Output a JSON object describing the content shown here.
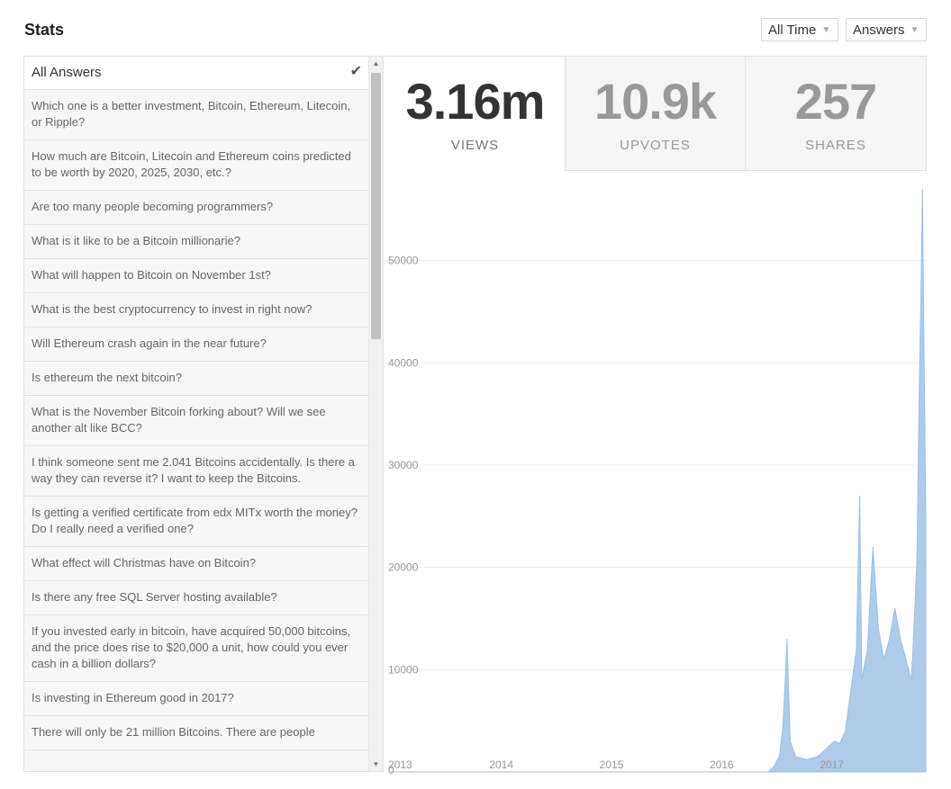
{
  "header": {
    "title": "Stats"
  },
  "filters": {
    "time": "All Time",
    "type": "Answers"
  },
  "sidebar": {
    "selected_label": "All Answers",
    "items": [
      "Which one is a better investment, Bitcoin, Ethereum, Litecoin, or Ripple?",
      "How much are Bitcoin, Litecoin and Ethereum coins predicted to be worth by 2020, 2025, 2030, etc.?",
      "Are too many people becoming programmers?",
      "What is it like to be a Bitcoin millionarie?",
      "What will happen to Bitcoin on November 1st?",
      "What is the best cryptocurrency to invest in right now?",
      "Will Ethereum crash again in the near future?",
      "Is ethereum the next bitcoin?",
      "What is the November Bitcoin forking about? Will we see another alt like BCC?",
      "I think someone sent me 2.041 Bitcoins accidentally. Is there a way they can reverse it? I want to keep the Bitcoins.",
      "Is getting a verified certificate from edx MITx worth the money? Do I really need a verified one?",
      "What effect will Christmas have on Bitcoin?",
      "Is there any free SQL Server hosting available?",
      "If you invested early in bitcoin, have acquired 50,000 bitcoins, and the price does rise to $20,000 a unit, how could you ever cash in a billion dollars?",
      "Is investing in Ethereum good in 2017?",
      "There will only be 21 million Bitcoins. There are people"
    ]
  },
  "stats": {
    "views": {
      "value": "3.16m",
      "label": "VIEWS"
    },
    "upvotes": {
      "value": "10.9k",
      "label": "UPVOTES"
    },
    "shares": {
      "value": "257",
      "label": "SHARES"
    }
  },
  "icons": {
    "check": "check-icon",
    "caret": "caret-down-icon",
    "scroll_up": "arrow-up-icon",
    "scroll_down": "arrow-down-icon"
  },
  "colors": {
    "area_fill": "#aecbea",
    "area_stroke": "#9fbfe3",
    "grid": "#eeeeee"
  },
  "chart_data": {
    "type": "area",
    "series": [
      {
        "x": [
          2013.0,
          2016.45,
          2016.5,
          2016.55,
          2016.58,
          2016.6,
          2016.62,
          2016.65,
          2016.7,
          2016.8,
          2016.9,
          2017.0,
          2017.05,
          2017.1,
          2017.15,
          2017.2,
          2017.25,
          2017.28,
          2017.3,
          2017.35,
          2017.4,
          2017.45,
          2017.5,
          2017.55,
          2017.6,
          2017.65,
          2017.7,
          2017.75,
          2017.78,
          2017.8,
          2017.82,
          2017.84,
          2017.85,
          2017.86,
          2017.88
        ],
        "y": [
          0,
          0,
          500,
          1500,
          4000,
          8000,
          13000,
          3000,
          1500,
          1200,
          1500,
          2500,
          3000,
          2800,
          4000,
          8000,
          12000,
          27000,
          9000,
          12000,
          22000,
          14000,
          11000,
          13000,
          16000,
          13000,
          11000,
          9000,
          16000,
          21000,
          37000,
          49000,
          57000,
          45000,
          25000
        ]
      }
    ],
    "xlim": [
      2013,
      2017.88
    ],
    "ylim": [
      0,
      57000
    ],
    "x_ticks": [
      "2013",
      "2014",
      "2015",
      "2016",
      "2017"
    ],
    "y_ticks": [
      "0",
      "10000",
      "20000",
      "30000",
      "40000",
      "50000"
    ],
    "grid": true,
    "title": "",
    "xlabel": "",
    "ylabel": ""
  }
}
